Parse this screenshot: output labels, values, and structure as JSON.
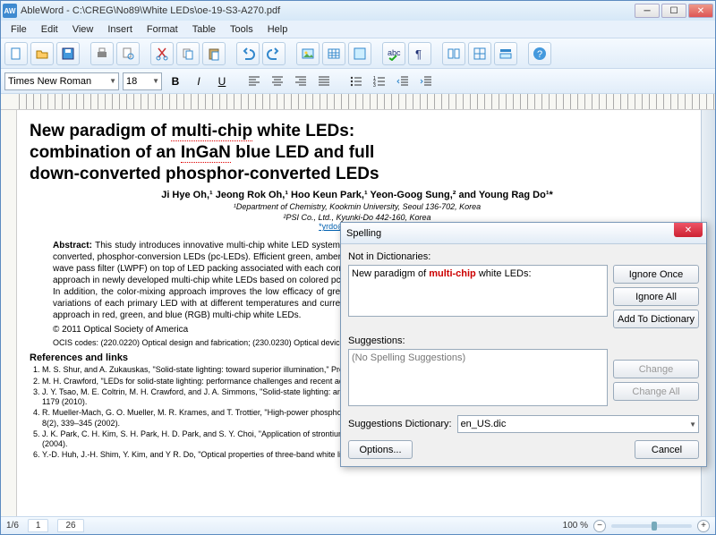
{
  "titlebar": {
    "title": "AbleWord - C:\\CREG\\No89\\White LEDs\\oe-19-S3-A270.pdf",
    "appicon_label": "AW"
  },
  "menu": [
    "File",
    "Edit",
    "View",
    "Insert",
    "Format",
    "Table",
    "Tools",
    "Help"
  ],
  "toolbar": {
    "font": "Times New Roman",
    "size": "18"
  },
  "document": {
    "heading_l1a": "New paradigm of ",
    "heading_err1": "multi-chip",
    "heading_l1b": " white LEDs:",
    "heading_l2a": "combination of an ",
    "heading_err2": "InGaN",
    "heading_l2b": " blue LED and full",
    "heading_l3": "down-converted phosphor-converted LEDs",
    "authors": "Ji Hye Oh,¹ Jeong Rok Oh,¹ Hoo Keun Park,¹ Yeon-Goog Sung,² and Young Rag Do¹*",
    "affil1": "¹Department of Chemistry, Kookmin University, Seoul 136-702, Korea",
    "affil2": "²PSI Co., Ltd., Kyunki-Do 442-160, Korea",
    "email": "*yrdo@kookmin.ac.kr",
    "abstract": "This study introduces innovative multi-chip white LED systems that combine an InGaN blue LED and green/red or green/amber/red full down-converted, phosphor-conversion LEDs (pc-LEDs). Efficient green, amber, and red full down-converted pc-LEDs were fabricated by simply capping a long-wave pass filter (LWPF) on top of LED packing associated with each corresponding powder phosphor. The principal advantage of this type of color-mixing approach in newly developed multi-chip white LEDs based on colored pc-LEDs is thought to be dynamic control of the chromaticity and better light quality. In addition, the color-mixing approach improves the low efficacy of green/amber LEDs in the \"green gap\" wavelength; reduces the wide color/efficacy variations of each primary LED with at different temperatures and currents; and improves the low color rendering indexes of the traditional color-mixing approach in red, green, and blue (RGB) multi-chip white LEDs.",
    "copyright": "© 2011 Optical Society of America",
    "ocis": "OCIS codes: (220.0220) Optical design and fabrication; (230.0230) Optical devices; (230.14) Bragg reflectors; (230.3670) Light-emitting diodes.",
    "refs_title": "References and links",
    "refs": [
      "M. S. Shur, and A. Zukauskas, \"Solid-state lighting: toward superior illumination,\" Proc. IEEE 93(10), 1691–1703 (2005).",
      "M. H. Crawford, \"LEDs for solid-state lighting: performance challenges and recent advances,\" IEEE J. Sel. Top. Quantum Electron. 15(4), 1028–1040 (2009).",
      "J. Y. Tsao, M. E. Coltrin, M. H. Crawford, and J. A. Simmons, \"Solid-state lighting: an integrated human factors, technology, and economic perspective,\" Proc. IEEE 98(7), 1162–1179 (2010).",
      "R. Mueller-Mach, G. O. Mueller, M. R. Krames, and T. Trottier, \"High-power phosphor-converted light-emitting diodes based on III-Nitrides,\" IEEE J. Sel. Top. Quantum Electron. 8(2), 339–345 (2002).",
      "J. K. Park, C. H. Kim, S. H. Park, H. D. Park, and S. Y. Choi, \"Application of strontium silicate yellow phosphor for white light-emitting diodes,\" Appl. Phys. Lett. 84(10), 1647–1649 (2004).",
      "Y.-D. Huh, J.-H. Shim, Y. Kim, and Y R. Do, \"Optical properties of three-band white light emitting diodes,\" J"
    ]
  },
  "spelling": {
    "title": "Spelling",
    "notin_label": "Not in Dictionaries:",
    "notin_pre": "New paradigm of ",
    "notin_err": "multi-chip",
    "notin_post": " white LEDs:",
    "sug_label": "Suggestions:",
    "sug_text": "(No Spelling Suggestions)",
    "ignore_once": "Ignore Once",
    "ignore_all": "Ignore All",
    "add": "Add To Dictionary",
    "change": "Change",
    "change_all": "Change All",
    "dict_label": "Suggestions Dictionary:",
    "dict_value": "en_US.dic",
    "options": "Options...",
    "cancel": "Cancel"
  },
  "status": {
    "page": "1/6",
    "tabs": [
      "1",
      "26"
    ],
    "zoom": "100 %"
  }
}
